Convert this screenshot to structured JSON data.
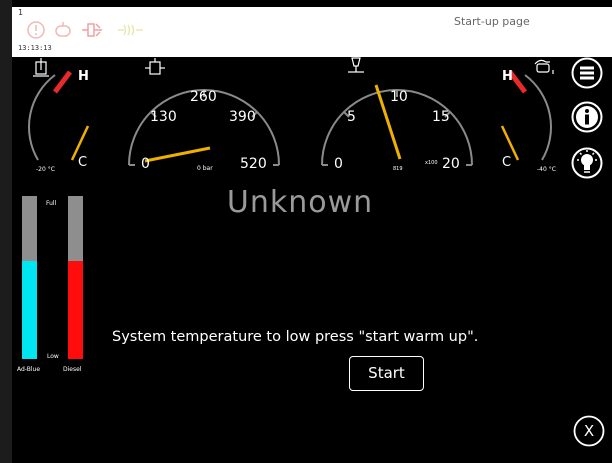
{
  "header": {
    "marker": "1",
    "clock": "13:13:13",
    "page_title": "Start-up page",
    "warning_icons": [
      "stop-warning-icon",
      "engine-warning-icon",
      "battery-warning-icon",
      "preheat-icon"
    ]
  },
  "gauges": {
    "coolant_temp": {
      "high_label": "H",
      "low_label": "C",
      "min_label": "-20 °C",
      "icon": "coolant-temperature-icon"
    },
    "oil_pressure": {
      "ticks": [
        "0",
        "130",
        "260",
        "390",
        "520"
      ],
      "unit": "0 bar",
      "icon": "oil-pressure-icon"
    },
    "engine_rpm": {
      "ticks": [
        "0",
        "5",
        "10",
        "15",
        "20"
      ],
      "unit": "x100",
      "readout": "819",
      "icon": "oil-lamp-icon"
    },
    "oil_temp": {
      "high_label": "H",
      "low_label": "C",
      "min_label": "-40 °C",
      "icon": "oil-temperature-icon"
    }
  },
  "status": "Unknown",
  "levels": {
    "full_label": "Full",
    "low_label": "Low",
    "adblue": {
      "label": "Ad-Blue",
      "level": 0.6,
      "color": "#00e6f0"
    },
    "diesel": {
      "label": "Diesel",
      "level": 0.6,
      "color": "#ff0d0d"
    }
  },
  "message": "System temperature to low press \"start warm up\".",
  "start_button": "Start",
  "side_menu": [
    "menu-icon",
    "info-icon",
    "light-bulb-icon"
  ],
  "close_button": "X"
}
